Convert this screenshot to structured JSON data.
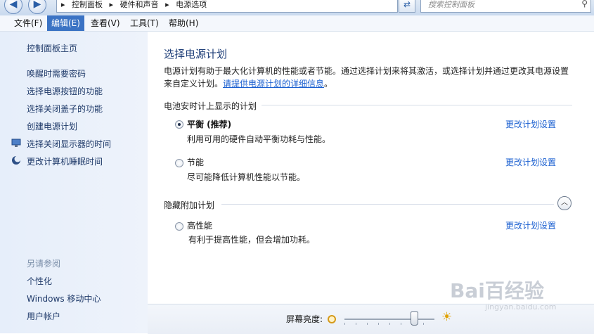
{
  "address_bar": {
    "breadcrumbs": [
      "控制面板",
      "硬件和声音",
      "电源选项"
    ],
    "search_placeholder": "搜索控制面板"
  },
  "menu": [
    {
      "label": "文件(F)",
      "selected": false
    },
    {
      "label": "编辑(E)",
      "selected": true
    },
    {
      "label": "查看(V)",
      "selected": false
    },
    {
      "label": "工具(T)",
      "selected": false
    },
    {
      "label": "帮助(H)",
      "selected": false
    }
  ],
  "sidebar": {
    "home": "控制面板主页",
    "links": [
      {
        "label": "唤醒时需要密码"
      },
      {
        "label": "选择电源按钮的功能"
      },
      {
        "label": "选择关闭盖子的功能"
      },
      {
        "label": "创建电源计划"
      },
      {
        "label": "选择关闭显示器的时间",
        "icon": "monitor-icon"
      },
      {
        "label": "更改计算机睡眠时间",
        "icon": "moon-icon"
      }
    ],
    "see_also_title": "另请参阅",
    "see_also": [
      {
        "label": "个性化"
      },
      {
        "label": "Windows 移动中心"
      },
      {
        "label": "用户帐户"
      }
    ]
  },
  "main": {
    "title": "选择电源计划",
    "description": "电源计划有助于最大化计算机的性能或者节能。通过选择计划来将其激活，或选择计划并通过更改其电源设置来自定义计划。",
    "description_link": "请提供电源计划的详细信息",
    "section_battery": "电池安时计上显示的计划",
    "section_hidden": "隐藏附加计划",
    "change_label": "更改计划设置",
    "plans": [
      {
        "name": "平衡 (推荐)",
        "desc": "利用可用的硬件自动平衡功耗与性能。",
        "checked": true
      },
      {
        "name": "节能",
        "desc": "尽可能降低计算机性能以节能。",
        "checked": false
      },
      {
        "name": "高性能",
        "desc": "有利于提高性能，但会增加功耗。",
        "checked": false
      }
    ]
  },
  "footer": {
    "brightness_label": "屏幕亮度:",
    "brightness_level": 0.77
  },
  "watermark": {
    "text": "Bai百经验",
    "url": "jingyan.baidu.com"
  },
  "colors": {
    "link": "#1a5fd0",
    "title": "#1e3e78",
    "menu_selected": "#3b73c4"
  }
}
